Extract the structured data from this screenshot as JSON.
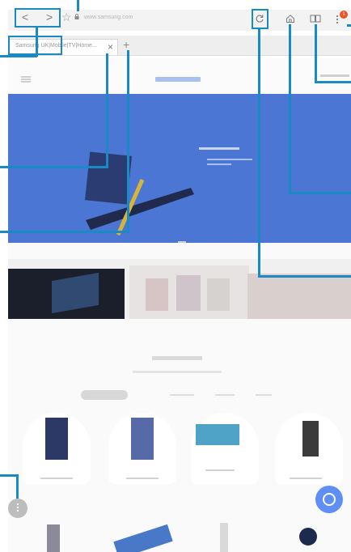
{
  "browser": {
    "back_label": "<",
    "forward_label": ">",
    "bookmark_icon": "star-icon",
    "url": "www.samsung.com",
    "tab_title": "Samsung UK|Mobile|TV|Home...",
    "tab_close": "×",
    "new_tab": "+",
    "reload_icon": "reload-icon",
    "home_icon": "home-icon",
    "bookmarks_icon": "bookmarks-icon",
    "menu_icon": "more-vertical-icon",
    "badge_count": "1"
  },
  "page": {
    "icons": [
      "hamburger-icon",
      "more-options-icon",
      "chat-icon"
    ]
  },
  "colors": {
    "callout": "#1a8ac4",
    "hero": "#4b76d3",
    "badge": "#e8552a"
  }
}
